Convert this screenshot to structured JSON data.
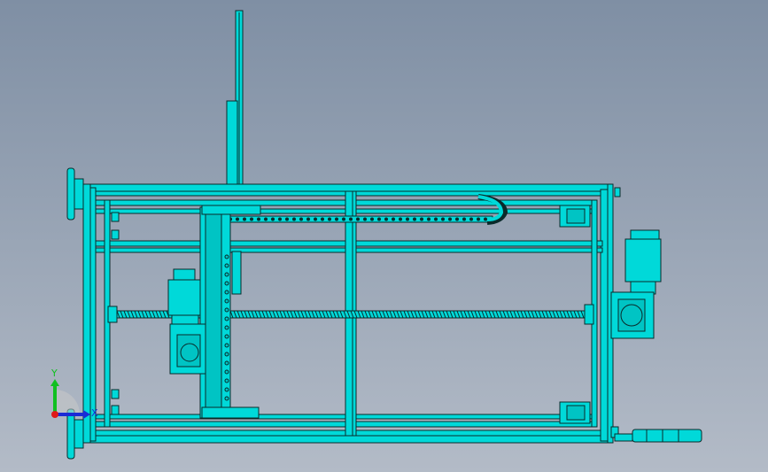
{
  "viewport": {
    "background_top": "#7f8fa4",
    "background_bottom": "#b3bbc7",
    "model_color": "#00d9d9",
    "edge_color": "#0a2a2a"
  },
  "triad": {
    "x_label": "X",
    "y_label": "Y",
    "x_color": "#1a2bd6",
    "y_color": "#10c020",
    "z_color": "#e01818"
  }
}
